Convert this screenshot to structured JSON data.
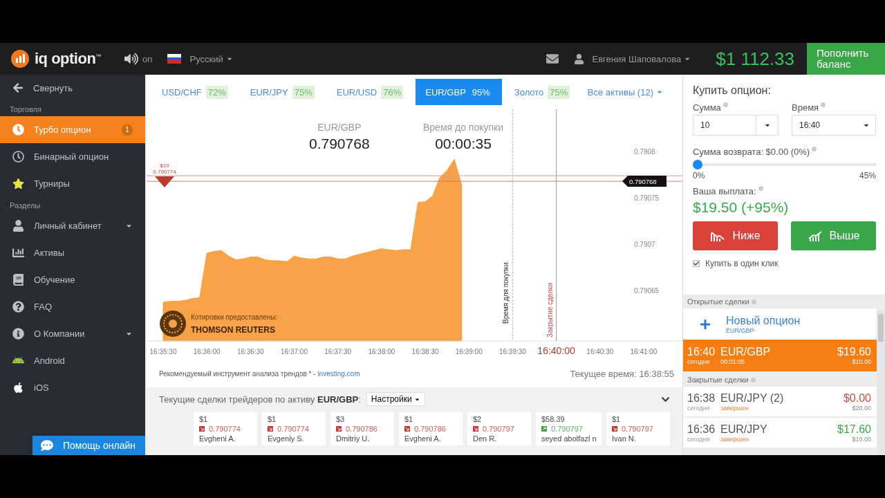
{
  "header": {
    "logo": "iq option$^{™}$",
    "sound": "on",
    "language": "Русский",
    "user": "Евгения Шаповалова",
    "balance": "$1 112.33",
    "deposit_button": "Пополнить баланс"
  },
  "sidebar": {
    "collapse": "Свернуть",
    "sections": [
      {
        "title": "Торговля",
        "items": [
          {
            "label": "Турбо опцион",
            "selected": true,
            "badge": "1",
            "expandable": false
          },
          {
            "label": "Бинарный опцион",
            "selected": false,
            "expandable": false
          },
          {
            "label": "Турниры",
            "selected": false,
            "expandable": false
          }
        ]
      },
      {
        "title": "Разделы",
        "items": [
          {
            "label": "Личный кабинет",
            "selected": false,
            "expandable": true
          },
          {
            "label": "Активы",
            "selected": false,
            "expandable": false
          },
          {
            "label": "Обучение",
            "selected": false,
            "expandable": false
          },
          {
            "label": "FAQ",
            "selected": false,
            "expandable": false
          },
          {
            "label": "О Компании",
            "selected": false,
            "expandable": true
          },
          {
            "label": "Android",
            "selected": false,
            "expandable": false
          },
          {
            "label": "iOS",
            "selected": false,
            "expandable": false
          }
        ]
      }
    ],
    "help_button": "Помощь онлайн"
  },
  "asset_tabs": [
    {
      "label": "USD/CHF",
      "percent": "72%",
      "selected": false
    },
    {
      "label": "EUR/JPY",
      "percent": "75%",
      "selected": false
    },
    {
      "label": "EUR/USD",
      "percent": "76%",
      "selected": false
    },
    {
      "label": "EUR/GBP",
      "percent": "95%",
      "selected": true
    },
    {
      "label": "Золото",
      "percent": "75%",
      "selected": false
    }
  ],
  "all_assets": "Все активы (12)",
  "chart": {
    "asset": "EUR/GBP",
    "price": "0.790768",
    "countdown_label": "Время до покупки",
    "countdown": "00:00:35",
    "provider_caption": "Котировки предоставлены:",
    "provider_name": "THOMSON REUTERS",
    "bet_amount": "$10",
    "chart_data": {
      "type": "area",
      "categories": [
        "16:35:30",
        null,
        null,
        null,
        null,
        null,
        "16:36:00",
        null,
        null,
        null,
        null,
        null,
        "16:36:30",
        null,
        null,
        null,
        null,
        null,
        "16:37:00",
        null,
        null,
        null,
        null,
        null,
        "16:37:30",
        null,
        null,
        null,
        null,
        null,
        "16:38:00",
        null,
        null,
        null,
        null,
        null,
        "16:38:30",
        null,
        null,
        null,
        null,
        null,
        "16:39:00",
        null,
        null,
        null,
        null,
        null,
        "16:39:30",
        null,
        null,
        null,
        null,
        null,
        "16:40:00",
        null,
        null,
        null,
        null,
        null,
        "16:40:30",
        null,
        null,
        null,
        null,
        null,
        "16:41:00"
      ],
      "series": [
        {
          "color": "#f7a247",
          "values": [
            0.790637,
            0.790638,
            0.790638,
            0.790639,
            0.790641,
            0.790642,
            0.79069,
            0.790692,
            0.790693,
            0.790687,
            0.790683,
            0.790684,
            0.790686,
            0.790686,
            0.790683,
            0.790682,
            0.790682,
            0.790681,
            0.790687,
            0.790685,
            0.790684,
            0.790684,
            0.790686,
            0.790686,
            0.790684,
            0.790684,
            0.790687,
            0.790689,
            0.790691,
            0.790693,
            0.790695,
            0.790694,
            0.790693,
            0.790694,
            0.790694,
            0.790745,
            0.790746,
            0.790752,
            0.790772,
            0.79078,
            0.790792,
            0.790764,
            null,
            null,
            null,
            null,
            null,
            null,
            null,
            null,
            null,
            null,
            null,
            null,
            null,
            null,
            null,
            null,
            null,
            null,
            null,
            null,
            null,
            null,
            null,
            null,
            null
          ]
        }
      ],
      "ylim": [
        0.790595,
        0.790846
      ],
      "yticks": [
        0.7908,
        0.79075,
        0.7907,
        0.79065
      ],
      "ref_lines": [
        {
          "axis": "y",
          "value": 0.790774,
          "label": "0.790774",
          "color": "#dd9999"
        },
        {
          "axis": "y",
          "value": 0.790768,
          "label": "0.790768",
          "color": "#cc7777"
        }
      ],
      "annotations": [
        "Время для покупки",
        "Закрытие сделки"
      ]
    }
  },
  "footer": {
    "recommendation": "Рекомендуемый инструмент анализа трендов * - ",
    "link": "investing.com",
    "current_time_label": "Текущее время:",
    "current_time": "16:38:55"
  },
  "traders": {
    "title": "Текущие сделки трейдеров по активу **EUR/GBP**:",
    "settings": "Настройки",
    "deals": [
      {
        "amount": "$1",
        "rising": false,
        "price": "0.790774",
        "name": "Evgheni A."
      },
      {
        "amount": "$1",
        "rising": false,
        "price": "0.790774",
        "name": "Evgeniy S."
      },
      {
        "amount": "$3",
        "rising": false,
        "price": "0.790786",
        "name": "Dmitriy U."
      },
      {
        "amount": "$1",
        "rising": false,
        "price": "0.790786",
        "name": "Evgheni A."
      },
      {
        "amount": "$2",
        "rising": false,
        "price": "0.790797",
        "name": "Den R."
      },
      {
        "amount": "$58.39",
        "rising": true,
        "price": "0.790797",
        "name": "seyed abolfazl n"
      },
      {
        "amount": "$1",
        "rising": false,
        "price": "0.790797",
        "name": "Ivan N."
      }
    ]
  },
  "buy": {
    "title": "Купить опцион:",
    "amount_label": "Сумма",
    "amount": "10",
    "time_label": "Время",
    "time": "16:40",
    "refund_label": "Сумма возврата: $0.00 (0%)",
    "refund_slider": {
      "level": 0,
      "min_label": "0%",
      "max_label": "45%"
    },
    "payout_label": "Ваша выплата:",
    "payout": "$19.50 (+95%)",
    "lower_button": "Ниже",
    "higher_button": "Выше",
    "one_click": {
      "label": "Купить в один клик",
      "checked": true
    }
  },
  "open_deals": {
    "title": "Открытые сделки",
    "new_option": {
      "label": "Новый опцион",
      "asset": "EUR/GBP"
    },
    "deals": [
      {
        "time": "16:40",
        "day": "сегодня",
        "asset": "EUR/GBP",
        "sub": "00:01:05",
        "amount": "$19.60",
        "stake": "$10.00"
      }
    ]
  },
  "closed_deals": {
    "title": "Закрытые сделки",
    "deals": [
      {
        "time": "16:38",
        "day": "сегодня",
        "asset": "EUR/JPY (2)",
        "status": "завершен",
        "amount": "$0.00",
        "stake": "$20.00",
        "won": false
      },
      {
        "time": "16:36",
        "day": "сегодня",
        "asset": "EUR/JPY",
        "status": "завершен",
        "amount": "$17.60",
        "stake": "$10.00",
        "won": true
      }
    ]
  }
}
